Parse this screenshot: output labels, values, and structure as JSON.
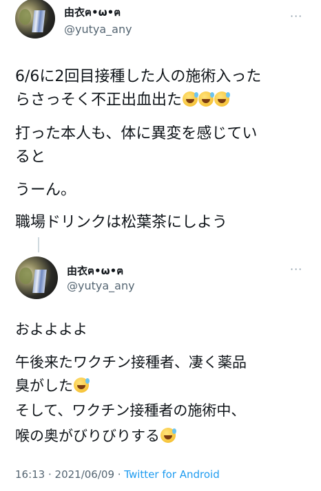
{
  "tweet1": {
    "display_name": "由衣ฅ•ω•ฅ",
    "handle": "@yutya_any",
    "more": "···",
    "lines": [
      "6/6に2回目接種した人の施術入った",
      "らさっそく不正出血出た",
      "打った本人も、体に異変を感じてい",
      "ると",
      "うーん。",
      "職場ドリンクは松葉茶にしよう"
    ],
    "emoji": "grinning-sweat-face"
  },
  "tweet2": {
    "display_name": "由衣ฅ•ω•ฅ",
    "handle": "@yutya_any",
    "more": "···",
    "lines": [
      "およよよよ",
      "午後来たワクチン接種者、凄く薬品",
      "臭がした",
      "そして、ワクチン接種者の施術中、",
      "喉の奥がびりびりする"
    ],
    "meta": {
      "time": "16:13 · 2021/06/09 · ",
      "source": "Twitter for Android"
    }
  }
}
